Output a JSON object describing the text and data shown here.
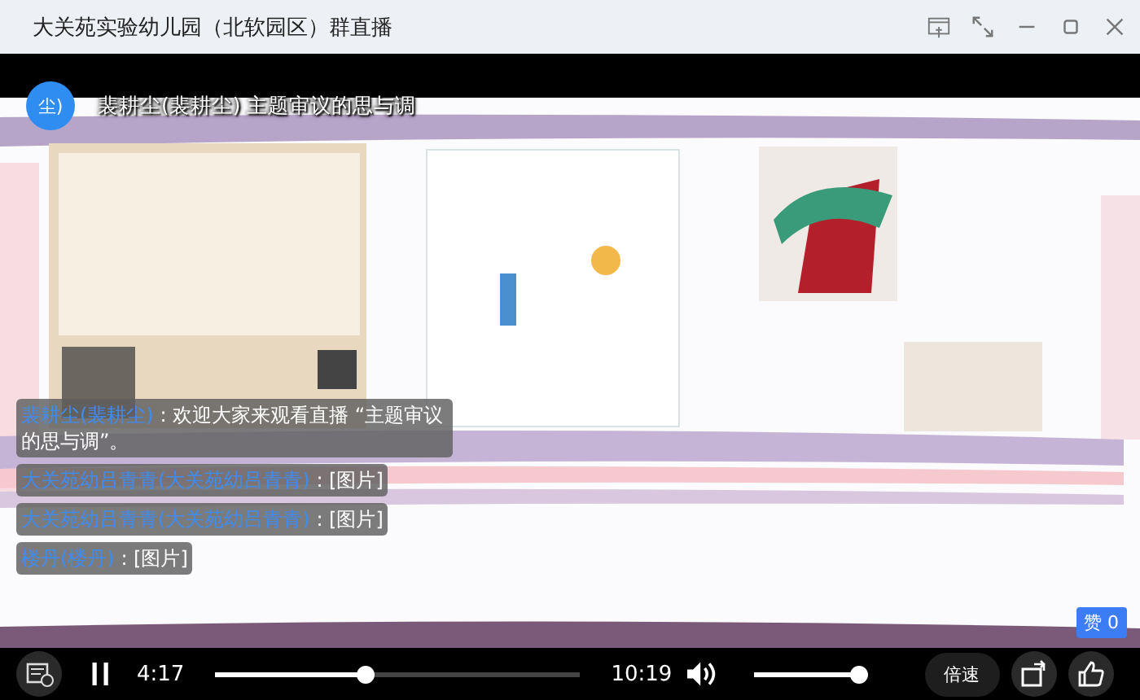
{
  "window": {
    "title": "大关苑实验幼儿园（北软园区）群直播"
  },
  "presenter": {
    "avatar_text": "尘)",
    "title": "裴耕尘(裴耕尘) 主题审议的思与调"
  },
  "chat": [
    {
      "name": "裴耕尘(裴耕尘)",
      "sep": ":",
      "text": "欢迎大家来观看直播 “主题审议的思与调”。"
    },
    {
      "name": "大关苑幼吕青青(大关苑幼吕青青)",
      "sep": ":",
      "text": "[图片]"
    },
    {
      "name": "大关苑幼吕青青(大关苑幼吕青青)",
      "sep": ":",
      "text": "[图片]"
    },
    {
      "name": "楼丹(楼丹)",
      "sep": ":",
      "text": "[图片]"
    }
  ],
  "likes": {
    "label": "赞 0"
  },
  "player": {
    "playing": true,
    "elapsed": "4:17",
    "progress": {
      "level": 0.41
    },
    "duration": "10:19",
    "volume": {
      "level": 0.95
    },
    "speed_button": "倍速"
  }
}
